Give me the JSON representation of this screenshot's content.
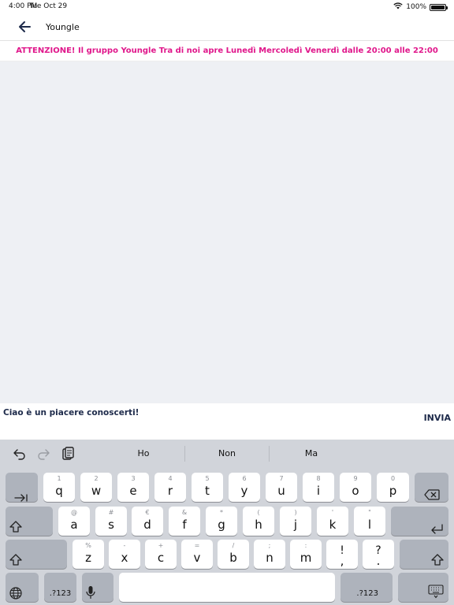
{
  "status_bar": {
    "time": "4:00 PM",
    "date": "Tue Oct 29",
    "battery_text": "100%"
  },
  "header": {
    "title": "Youngle",
    "back_icon": "arrow-left-icon"
  },
  "banner": {
    "text": "ATTENZIONE! Il gruppo Youngle Tra di noi apre Lunedì Mercoledì Venerdì dalle 20:00 alle 22:00",
    "color": "#e0178b"
  },
  "composer": {
    "message_text": "Ciao è un piacere conoscerti!",
    "send_label": "INVIA"
  },
  "keyboard": {
    "suggestions": [
      "Ho",
      "Non",
      "Ma"
    ],
    "row1": [
      {
        "alt": "1",
        "key": "q"
      },
      {
        "alt": "2",
        "key": "w"
      },
      {
        "alt": "3",
        "key": "e"
      },
      {
        "alt": "4",
        "key": "r"
      },
      {
        "alt": "5",
        "key": "t"
      },
      {
        "alt": "6",
        "key": "y"
      },
      {
        "alt": "7",
        "key": "u"
      },
      {
        "alt": "8",
        "key": "i"
      },
      {
        "alt": "9",
        "key": "o"
      },
      {
        "alt": "0",
        "key": "p"
      }
    ],
    "row2": [
      {
        "alt": "@",
        "key": "a"
      },
      {
        "alt": "#",
        "key": "s"
      },
      {
        "alt": "€",
        "key": "d"
      },
      {
        "alt": "&",
        "key": "f"
      },
      {
        "alt": "*",
        "key": "g"
      },
      {
        "alt": "(",
        "key": "h"
      },
      {
        "alt": ")",
        "key": "j"
      },
      {
        "alt": "'",
        "key": "k"
      },
      {
        "alt": "\"",
        "key": "l"
      }
    ],
    "row3": [
      {
        "alt": "%",
        "key": "z"
      },
      {
        "alt": "-",
        "key": "x"
      },
      {
        "alt": "+",
        "key": "c"
      },
      {
        "alt": "=",
        "key": "v"
      },
      {
        "alt": "/",
        "key": "b"
      },
      {
        "alt": ";",
        "key": "n"
      },
      {
        "alt": ":",
        "key": "m"
      },
      {
        "alt": "!",
        "key": ","
      },
      {
        "alt": "?",
        "key": "."
      }
    ],
    "numbers_label": ".?123"
  },
  "colors": {
    "text_dark": "#1d2a4a",
    "chat_background": "#eef0f4",
    "keyboard_background": "#d1d4da"
  }
}
